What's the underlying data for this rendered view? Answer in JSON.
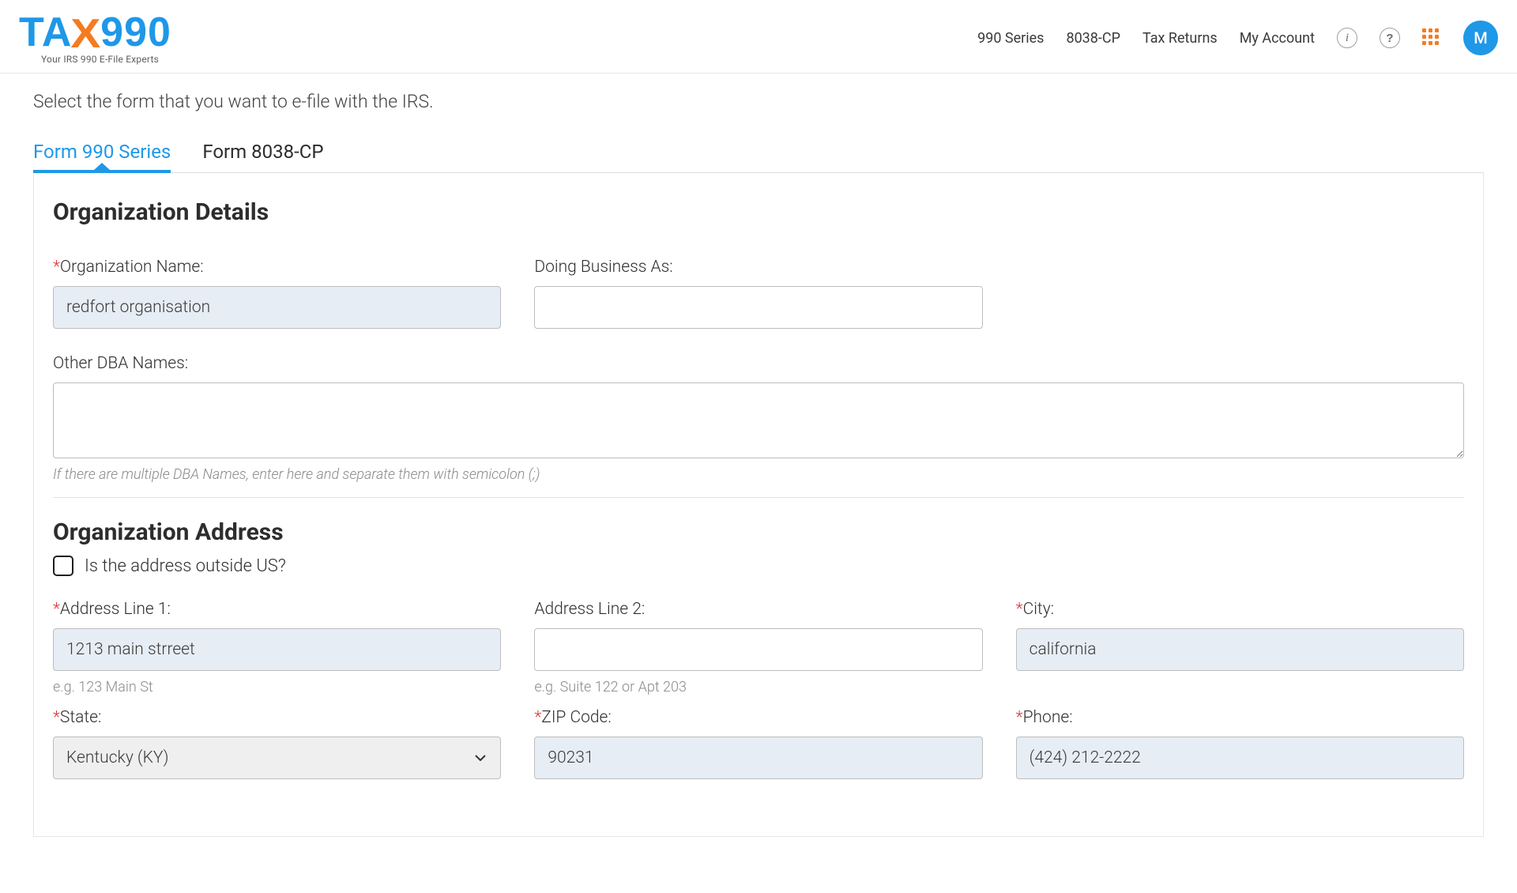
{
  "header": {
    "logo_tax": "TA",
    "logo_x": "X",
    "logo_990": "990",
    "tagline": "Your IRS 990 E-File Experts",
    "nav": {
      "series": "990 Series",
      "cp": "8038-CP",
      "returns": "Tax Returns",
      "account": "My Account"
    },
    "avatar_initial": "M"
  },
  "page": {
    "subtitle": "Select the form that you want to e-file with the IRS.",
    "tabs": {
      "form990": "Form 990 Series",
      "form8038": "Form 8038-CP"
    }
  },
  "org_details": {
    "heading": "Organization Details",
    "labels": {
      "org_name": "Organization Name:",
      "dba": "Doing Business As:",
      "other_dba": "Other DBA Names:"
    },
    "values": {
      "org_name": "redfort organisation",
      "dba": "",
      "other_dba": ""
    },
    "hints": {
      "other_dba": "If there are multiple DBA Names, enter here and separate them with semicolon (;)"
    }
  },
  "org_address": {
    "heading": "Organization Address",
    "outside_us_label": "Is the address outside US?",
    "labels": {
      "addr1": "Address Line 1:",
      "addr2": "Address Line 2:",
      "city": "City:",
      "state": "State:",
      "zip": "ZIP Code:",
      "phone": "Phone:"
    },
    "values": {
      "addr1": "1213 main strreet",
      "addr2": "",
      "city": "california",
      "state": "Kentucky (KY)",
      "zip": "90231",
      "phone": "(424) 212-2222"
    },
    "hints": {
      "addr1": "e.g. 123 Main St",
      "addr2": "e.g. Suite 122 or Apt 203"
    }
  }
}
